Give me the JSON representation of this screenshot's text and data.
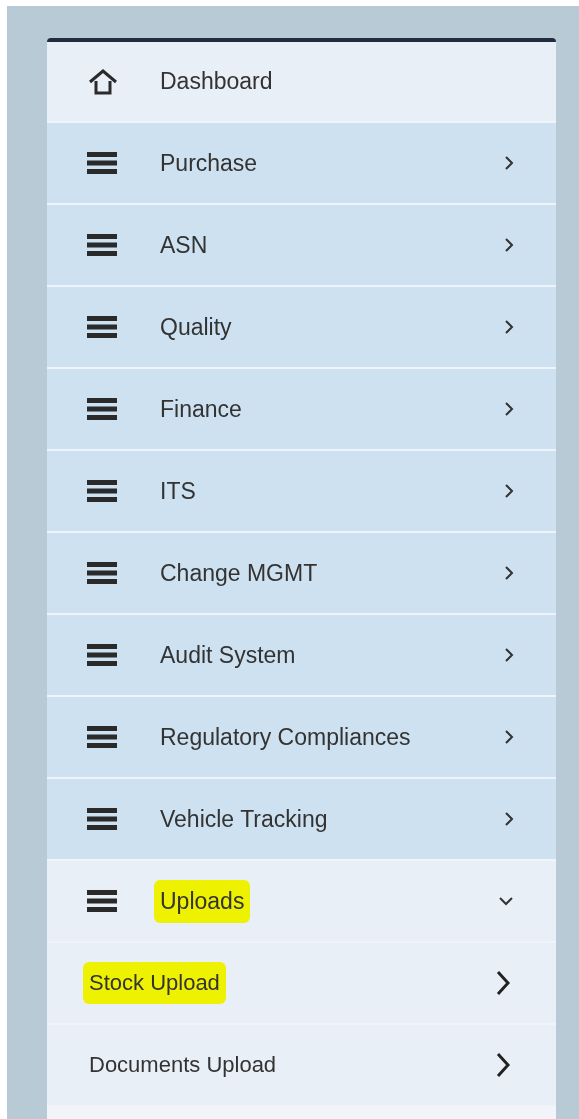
{
  "menu": [
    {
      "label": "Dashboard",
      "kind": "home",
      "highlighted": false
    },
    {
      "label": "Purchase",
      "kind": "list",
      "expanded": false,
      "highlighted": false
    },
    {
      "label": "ASN",
      "kind": "list",
      "expanded": false,
      "highlighted": false
    },
    {
      "label": "Quality",
      "kind": "list",
      "expanded": false,
      "highlighted": false
    },
    {
      "label": "Finance",
      "kind": "list",
      "expanded": false,
      "highlighted": false
    },
    {
      "label": "ITS",
      "kind": "list",
      "expanded": false,
      "highlighted": false
    },
    {
      "label": "Change MGMT",
      "kind": "list",
      "expanded": false,
      "highlighted": false
    },
    {
      "label": "Audit System",
      "kind": "list",
      "expanded": false,
      "highlighted": false
    },
    {
      "label": "Regulatory Compliances",
      "kind": "list",
      "expanded": false,
      "highlighted": false
    },
    {
      "label": "Vehicle Tracking",
      "kind": "list",
      "expanded": false,
      "highlighted": false
    },
    {
      "label": "Uploads",
      "kind": "list",
      "expanded": true,
      "highlighted": true,
      "children": [
        {
          "label": "Stock Upload",
          "highlighted": true
        },
        {
          "label": "Documents Upload",
          "highlighted": false
        }
      ]
    }
  ]
}
